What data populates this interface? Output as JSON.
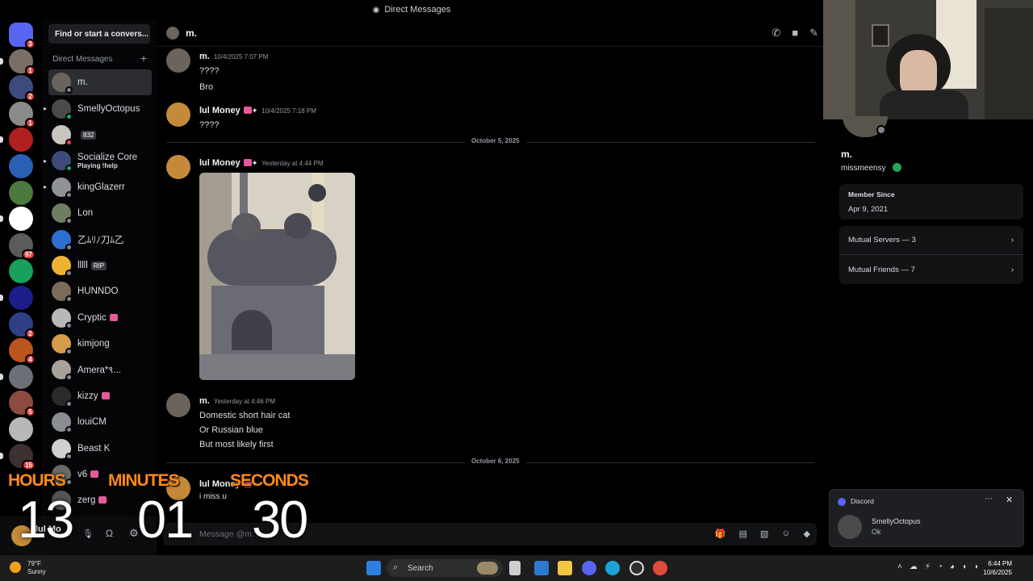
{
  "window": {
    "title": "Direct Messages"
  },
  "servers": [
    {
      "color": "#5865f2",
      "badge": "3",
      "type": "home"
    },
    {
      "color": "#7a6f66",
      "badge": "1"
    },
    {
      "color": "#3d4a7c",
      "badge": "2"
    },
    {
      "color": "#8a8a8a",
      "badge": "1"
    },
    {
      "color": "#b02020",
      "badge": ""
    },
    {
      "color": "#2a5fb3",
      "badge": ""
    },
    {
      "color": "#4c7a3e",
      "badge": ""
    },
    {
      "color": "#ffffff",
      "badge": ""
    },
    {
      "color": "#5b5b5b",
      "badge": "97"
    },
    {
      "color": "#19a05a",
      "badge": ""
    },
    {
      "color": "#1b1d8a",
      "badge": ""
    },
    {
      "color": "#2f3f86",
      "badge": "2"
    },
    {
      "color": "#b9551d",
      "badge": "4"
    },
    {
      "color": "#6b6f76",
      "badge": ""
    },
    {
      "color": "#8d4a3e",
      "badge": "5"
    },
    {
      "color": "#b8b8b8",
      "badge": ""
    },
    {
      "color": "#3d3030",
      "badge": "15"
    }
  ],
  "sidebar": {
    "search_placeholder": "Find or start a convers...",
    "heading": "Direct Messages",
    "add_label": "+",
    "items": [
      {
        "name": "m.",
        "sub": "",
        "tag": "",
        "color": "#6a645c",
        "status": "#80848e",
        "active": true
      },
      {
        "name": "SmellyOctopus",
        "sub": "",
        "tag": "",
        "color": "#4a4a4a",
        "status": "#23a55a"
      },
      {
        "name": "",
        "sub": "",
        "tag": "832",
        "color": "#c9c6c2",
        "status": "#f23f43"
      },
      {
        "name": "Socialize Core",
        "sub": "Playing !help",
        "tag": "",
        "color": "#3e4a78",
        "status": "#23a55a"
      },
      {
        "name": "kingGlazerr",
        "sub": "",
        "tag": "",
        "color": "#8f9398",
        "status": "#80848e"
      },
      {
        "name": "Lon",
        "sub": "",
        "tag": "",
        "color": "#6f7d63",
        "status": "#80848e"
      },
      {
        "name": "乙ﾑﾘﾉ刀ﾑ乙",
        "sub": "",
        "tag": "",
        "color": "#2f6ed1",
        "status": "#80848e"
      },
      {
        "name": "lllll",
        "sub": "",
        "tag": "RIP",
        "color": "#f0b232",
        "status": "#80848e"
      },
      {
        "name": "HUNNDO",
        "sub": "",
        "tag": "",
        "color": "#7c6b58",
        "status": "#80848e"
      },
      {
        "name": "Cryptic",
        "sub": "",
        "tag": "",
        "color": "#b8b8b8",
        "status": "#80848e",
        "emoji": true
      },
      {
        "name": "kimjong",
        "sub": "",
        "tag": "",
        "color": "#d49b4a",
        "status": "#80848e"
      },
      {
        "name": "Amera*९...",
        "sub": "",
        "tag": "",
        "color": "#a9a29b",
        "status": "#80848e"
      },
      {
        "name": "kizzy",
        "sub": "",
        "tag": "",
        "color": "#2a2a2a",
        "status": "#80848e",
        "emoji": true
      },
      {
        "name": "louiCM",
        "sub": "",
        "tag": "",
        "color": "#8a8d93",
        "status": "#80848e"
      },
      {
        "name": "Beast K",
        "sub": "",
        "tag": "",
        "color": "#d0d0d0",
        "status": "#80848e"
      },
      {
        "name": "v6",
        "sub": "",
        "tag": "",
        "color": "#6a6a6a",
        "status": "#80848e",
        "emoji": true
      },
      {
        "name": "zerg",
        "sub": "",
        "tag": "",
        "color": "#555555",
        "status": "#80848e",
        "emoji": true
      }
    ]
  },
  "user_panel": {
    "name": "lul Mo"
  },
  "chat": {
    "recipient": "m.",
    "messages": [
      {
        "author": "m.",
        "time": "10/4/2025 7:07 PM",
        "lines": [
          "????",
          "Bro"
        ]
      },
      {
        "author": "lul Money",
        "time": "10/4/2025 7:18 PM",
        "lines": [
          "????"
        ]
      },
      {
        "author": "lul Money",
        "time": "Yesterday at 4:44 PM",
        "lines": []
      },
      {
        "author": "m.",
        "time": "Yesterday at 4:46 PM",
        "lines": [
          "Domestic short hair cat",
          "Or Russian blue",
          "But most likely first"
        ]
      },
      {
        "author": "lul Money",
        "time": "",
        "lines": [
          "i miss u"
        ]
      }
    ],
    "dividers": [
      "October 5, 2025",
      "October 6, 2025"
    ],
    "composer_placeholder": "Message @m."
  },
  "profile": {
    "name": "m.",
    "username": "missmeensy",
    "member_since_label": "Member Since",
    "member_since": "Apr 9, 2021",
    "mutual_servers": "Mutual Servers — 3",
    "mutual_friends": "Mutual Friends — 7"
  },
  "notification": {
    "app": "Discord",
    "sender": "SmellyOctopus",
    "text": "Ok"
  },
  "timer": {
    "hours_label": "HOURS",
    "minutes_label": "MINUTES",
    "seconds_label": "SECONDS",
    "hours": "13",
    "minutes": "01",
    "seconds": "30"
  },
  "taskbar": {
    "temp": "79°F",
    "condition": "Sunny",
    "search_label": "Search",
    "time": "6:44 PM",
    "date": "10/6/2025"
  }
}
